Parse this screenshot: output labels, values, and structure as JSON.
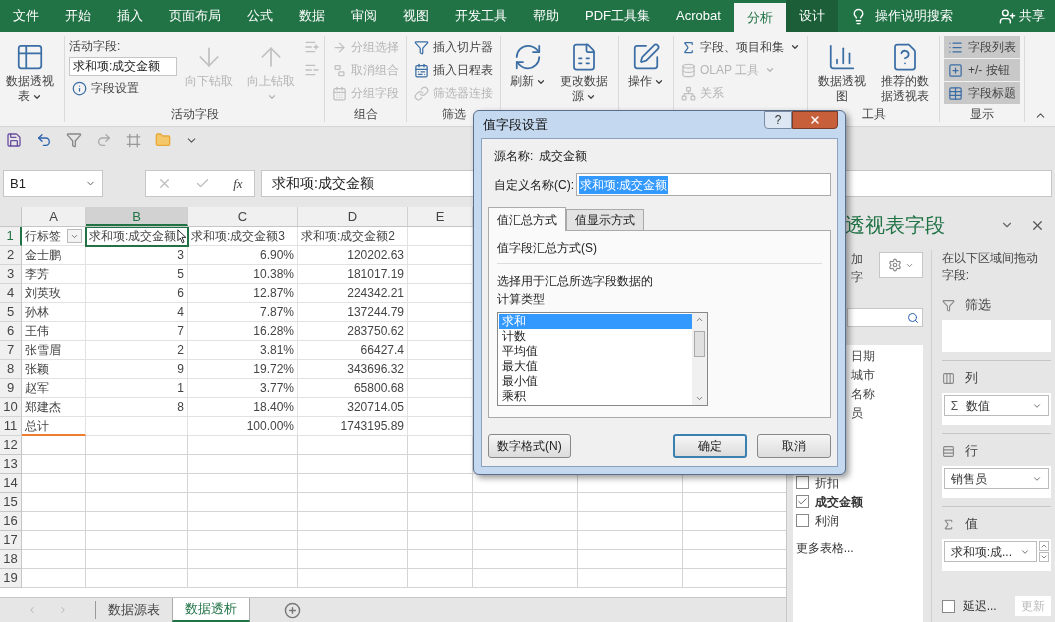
{
  "ribbon_tabs": [
    {
      "label": "文件",
      "selected": false,
      "contextual": false
    },
    {
      "label": "开始",
      "selected": false,
      "contextual": false
    },
    {
      "label": "插入",
      "selected": false,
      "contextual": false
    },
    {
      "label": "页面布局",
      "selected": false,
      "contextual": false
    },
    {
      "label": "公式",
      "selected": false,
      "contextual": false
    },
    {
      "label": "数据",
      "selected": false,
      "contextual": false
    },
    {
      "label": "审阅",
      "selected": false,
      "contextual": false
    },
    {
      "label": "视图",
      "selected": false,
      "contextual": false
    },
    {
      "label": "开发工具",
      "selected": false,
      "contextual": false
    },
    {
      "label": "帮助",
      "selected": false,
      "contextual": false
    },
    {
      "label": "PDF工具集",
      "selected": false,
      "contextual": false
    },
    {
      "label": "Acrobat",
      "selected": false,
      "contextual": false
    },
    {
      "label": "分析",
      "selected": true,
      "contextual": true
    },
    {
      "label": "设计",
      "selected": false,
      "contextual": true
    }
  ],
  "tell_me": "操作说明搜索",
  "share": "共享",
  "ribbon_groups": [
    {
      "columns": [
        [
          {
            "kind": "large",
            "label": "数据透视表",
            "disabled": false,
            "dropdown": true
          }
        ]
      ]
    },
    {
      "label": "活动字段",
      "columns": [
        [
          {
            "kind": "label",
            "label": "活动字段:"
          },
          {
            "kind": "field",
            "label": "求和项:成交金额"
          },
          {
            "kind": "small",
            "label": "字段设置",
            "disabled": false,
            "dropdown": false
          }
        ],
        [
          {
            "kind": "large",
            "label": "向下钻取",
            "disabled": true,
            "dropdown": false
          }
        ],
        [
          {
            "kind": "large",
            "label": "向上钻取",
            "disabled": true,
            "dropdown": true
          }
        ],
        [
          {
            "kind": "icon",
            "disabled": true
          },
          {
            "kind": "icon",
            "disabled": true
          }
        ]
      ]
    },
    {
      "label": "组合",
      "columns": [
        [
          {
            "kind": "small",
            "label": "分组选择",
            "disabled": true,
            "dropdown": false
          },
          {
            "kind": "small",
            "label": "取消组合",
            "disabled": true,
            "dropdown": false
          },
          {
            "kind": "small",
            "label": "分组字段",
            "disabled": true,
            "dropdown": false
          }
        ]
      ]
    },
    {
      "label": "筛选",
      "columns": [
        [
          {
            "kind": "small",
            "label": "插入切片器",
            "disabled": false,
            "dropdown": false
          },
          {
            "kind": "small",
            "label": "插入日程表",
            "disabled": false,
            "dropdown": false
          },
          {
            "kind": "small",
            "label": "筛选器连接",
            "disabled": true,
            "dropdown": false
          }
        ]
      ]
    },
    {
      "columns": [
        [
          {
            "kind": "large",
            "label": "刷新",
            "disabled": false,
            "dropdown": true
          }
        ],
        [
          {
            "kind": "large",
            "label": "更改数据源",
            "disabled": false,
            "dropdown": true
          }
        ]
      ]
    },
    {
      "columns": [
        [
          {
            "kind": "large",
            "label": "操作",
            "disabled": false,
            "dropdown": true
          }
        ]
      ]
    },
    {
      "columns": [
        [
          {
            "kind": "small",
            "label": "字段、项目和集",
            "disabled": false,
            "dropdown": true
          },
          {
            "kind": "small",
            "label": "OLAP 工具",
            "disabled": true,
            "dropdown": true
          },
          {
            "kind": "small",
            "label": "关系",
            "disabled": true,
            "dropdown": false
          }
        ]
      ]
    },
    {
      "label": "工具",
      "columns": [
        [
          {
            "kind": "large",
            "label": "数据透视图",
            "disabled": false,
            "dropdown": false
          }
        ],
        [
          {
            "kind": "large",
            "label": "推荐的数据透视表",
            "disabled": false,
            "dropdown": false
          }
        ]
      ]
    },
    {
      "label": "显示",
      "columns": [
        [
          {
            "kind": "toggle",
            "label": "字段列表",
            "on": true
          },
          {
            "kind": "toggle",
            "label": "+/- 按钮",
            "on": true
          },
          {
            "kind": "toggle",
            "label": "字段标题",
            "on": true
          }
        ]
      ]
    }
  ],
  "name_box": "B1",
  "fx": "fx",
  "formula": "求和项:成交金额",
  "columns": [
    {
      "label": "A",
      "selected": false
    },
    {
      "label": "B",
      "selected": true
    },
    {
      "label": "C",
      "selected": false
    },
    {
      "label": "D",
      "selected": false
    },
    {
      "label": "E",
      "selected": false
    }
  ],
  "rows": [
    {
      "number": "1",
      "selected": true,
      "cells": [
        "行标签",
        "求和项:成交金额",
        "求和项:成交金额3",
        "求和项:成交金额2"
      ]
    },
    {
      "number": "2",
      "selected": false,
      "cells": [
        "金士鹏",
        "3",
        "6.90%",
        "120202.63"
      ]
    },
    {
      "number": "3",
      "selected": false,
      "cells": [
        "李芳",
        "5",
        "10.38%",
        "181017.19"
      ]
    },
    {
      "number": "4",
      "selected": false,
      "cells": [
        "刘英玫",
        "6",
        "12.87%",
        "224342.21"
      ]
    },
    {
      "number": "5",
      "selected": false,
      "cells": [
        "孙林",
        "4",
        "7.87%",
        "137244.79"
      ]
    },
    {
      "number": "6",
      "selected": false,
      "cells": [
        "王伟",
        "7",
        "16.28%",
        "283750.62"
      ]
    },
    {
      "number": "7",
      "selected": false,
      "cells": [
        "张雪眉",
        "2",
        "3.81%",
        "66427.4"
      ]
    },
    {
      "number": "8",
      "selected": false,
      "cells": [
        "张颖",
        "9",
        "19.72%",
        "343696.32"
      ]
    },
    {
      "number": "9",
      "selected": false,
      "cells": [
        "赵军",
        "1",
        "3.77%",
        "65800.68"
      ]
    },
    {
      "number": "10",
      "selected": false,
      "cells": [
        "郑建杰",
        "8",
        "18.40%",
        "320714.05"
      ]
    },
    {
      "number": "11",
      "selected": false,
      "cells": [
        "总计",
        null,
        "100.00%",
        "1743195.89"
      ]
    }
  ],
  "empty_rows": [
    "12",
    "13",
    "14",
    "15",
    "16",
    "17",
    "18",
    "19"
  ],
  "sheet_tabs": [
    {
      "label": "数据源表",
      "selected": false
    },
    {
      "label": "数据透析",
      "selected": true
    }
  ],
  "dialog": {
    "title": "值字段设置",
    "help": "?",
    "source_label": "源名称:",
    "source_value": "成交金额",
    "custom_name_label": "自定义名称(C):",
    "custom_name_value": "求和项:成交金额",
    "tabs": [
      {
        "label": "值汇总方式",
        "selected": true
      },
      {
        "label": "值显示方式",
        "selected": false
      }
    ],
    "section_title": "值字段汇总方式(S)",
    "description": "选择用于汇总所选字段数据的计算类型",
    "functions": [
      {
        "label": "求和",
        "selected": true
      },
      {
        "label": "计数",
        "selected": false
      },
      {
        "label": "平均值",
        "selected": false
      },
      {
        "label": "最大值",
        "selected": false
      },
      {
        "label": "最小值",
        "selected": false
      },
      {
        "label": "乘积",
        "selected": false
      }
    ],
    "buttons": [
      {
        "label": "数字格式(N)",
        "default": false
      },
      {
        "label": "确定",
        "default": true
      },
      {
        "label": "取消",
        "default": false
      }
    ]
  },
  "field_pane": {
    "title": "透视表字段",
    "hint_lines": [
      "加",
      "字"
    ],
    "fields": [
      {
        "label": "日期",
        "kind": "partial"
      },
      {
        "label": "城市",
        "kind": "partial"
      },
      {
        "label": "名称",
        "kind": "partial"
      },
      {
        "label": "员",
        "kind": "partial"
      },
      {
        "label": "折扣",
        "kind": "checkbox",
        "checked": false
      },
      {
        "label": "成交金额",
        "kind": "checkbox",
        "checked": true
      },
      {
        "label": "利润",
        "kind": "checkbox",
        "checked": false
      }
    ],
    "more_tables": "更多表格...",
    "areas_hint": "在以下区域间拖动字段:",
    "areas": [
      {
        "kind": "filter",
        "label": "筛选"
      },
      {
        "kind": "columns",
        "label": "列",
        "chips": [
          {
            "symbol": "Σ",
            "label": "数值"
          }
        ]
      },
      {
        "kind": "rows",
        "label": "行",
        "chips": [
          {
            "label": "销售员"
          }
        ]
      },
      {
        "kind": "values",
        "label": "值",
        "chips": [
          {
            "label": "求和项:成..."
          }
        ]
      }
    ],
    "defer_label": "延迟...",
    "defer_checked": false,
    "update_button": "更新"
  }
}
